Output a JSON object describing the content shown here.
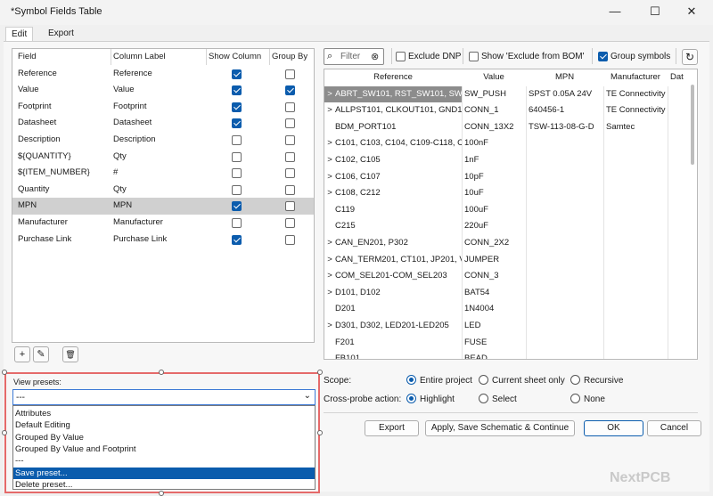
{
  "window": {
    "title": "*Symbol Fields Table",
    "minimize": "—",
    "maximize": "☐",
    "close": "✕"
  },
  "tabs": [
    "Edit",
    "Export"
  ],
  "fields_table": {
    "headers": [
      "Field",
      "Column Label",
      "Show Column",
      "Group By"
    ],
    "rows": [
      {
        "field": "Reference",
        "label": "Reference",
        "show": true,
        "group": false
      },
      {
        "field": "Value",
        "label": "Value",
        "show": true,
        "group": true
      },
      {
        "field": "Footprint",
        "label": "Footprint",
        "show": true,
        "group": false
      },
      {
        "field": "Datasheet",
        "label": "Datasheet",
        "show": true,
        "group": false
      },
      {
        "field": "Description",
        "label": "Description",
        "show": false,
        "group": false
      },
      {
        "field": "${QUANTITY}",
        "label": "Qty",
        "show": false,
        "group": false
      },
      {
        "field": "${ITEM_NUMBER}",
        "label": "#",
        "show": false,
        "group": false
      },
      {
        "field": "Quantity",
        "label": "Qty",
        "show": false,
        "group": false
      },
      {
        "field": "MPN",
        "label": "MPN",
        "show": true,
        "group": false,
        "selected": true
      },
      {
        "field": "Manufacturer",
        "label": "Manufacturer",
        "show": false,
        "group": false
      },
      {
        "field": "Purchase Link",
        "label": "Purchase Link",
        "show": true,
        "group": false
      }
    ]
  },
  "field_tools": {
    "add": "+",
    "edit": "✎",
    "delete": "🗑"
  },
  "filter": {
    "placeholder": "Filter",
    "clear": "⊗"
  },
  "options": {
    "exclude_dnp": {
      "label": "Exclude DNP",
      "checked": false
    },
    "show_excluded": {
      "label": "Show 'Exclude from BOM'",
      "checked": false
    },
    "group_symbols": {
      "label": "Group symbols",
      "checked": true
    }
  },
  "refresh_icon": "↻",
  "grid": {
    "headers": [
      "Reference",
      "Value",
      "MPN",
      "Manufacturer",
      "Dat"
    ],
    "sort_indicator": "^",
    "rows": [
      {
        "exp": ">",
        "ref": "ABRT_SW101, RST_SW101, SW201",
        "value": "SW_PUSH",
        "mpn": "SPST 0.05A 24V",
        "mfr": "TE Connectivity",
        "selected": true
      },
      {
        "exp": ">",
        "ref": "ALLPST101, CLKOUT101, GND101",
        "value": "CONN_1",
        "mpn": "640456-1",
        "mfr": "TE Connectivity"
      },
      {
        "exp": "",
        "ref": "BDM_PORT101",
        "value": "CONN_13X2",
        "mpn": "TSW-113-08-G-D",
        "mfr": "Samtec"
      },
      {
        "exp": ">",
        "ref": "C101, C103, C104, C109-C118, C2",
        "value": "100nF",
        "mpn": "",
        "mfr": ""
      },
      {
        "exp": ">",
        "ref": "C102, C105",
        "value": "1nF",
        "mpn": "",
        "mfr": ""
      },
      {
        "exp": ">",
        "ref": "C106, C107",
        "value": "10pF",
        "mpn": "",
        "mfr": ""
      },
      {
        "exp": ">",
        "ref": "C108, C212",
        "value": "10uF",
        "mpn": "",
        "mfr": ""
      },
      {
        "exp": "",
        "ref": "C119",
        "value": "100uF",
        "mpn": "",
        "mfr": ""
      },
      {
        "exp": "",
        "ref": "C215",
        "value": "220uF",
        "mpn": "",
        "mfr": ""
      },
      {
        "exp": ">",
        "ref": "CAN_EN201, P302",
        "value": "CONN_2X2",
        "mpn": "",
        "mfr": ""
      },
      {
        "exp": ">",
        "ref": "CAN_TERM201, CT101, JP201, VDD",
        "value": "JUMPER",
        "mpn": "",
        "mfr": ""
      },
      {
        "exp": ">",
        "ref": "COM_SEL201-COM_SEL203",
        "value": "CONN_3",
        "mpn": "",
        "mfr": ""
      },
      {
        "exp": ">",
        "ref": "D101, D102",
        "value": "BAT54",
        "mpn": "",
        "mfr": ""
      },
      {
        "exp": "",
        "ref": "D201",
        "value": "1N4004",
        "mpn": "",
        "mfr": ""
      },
      {
        "exp": ">",
        "ref": "D301, D302, LED201-LED205",
        "value": "LED",
        "mpn": "",
        "mfr": ""
      },
      {
        "exp": "",
        "ref": "F201",
        "value": "FUSE",
        "mpn": "",
        "mfr": ""
      },
      {
        "exp": "",
        "ref": "FB101",
        "value": "BEAD",
        "mpn": "",
        "mfr": ""
      }
    ]
  },
  "scope": {
    "label": "Scope:",
    "options": [
      "Entire project",
      "Current sheet only",
      "Recursive"
    ],
    "selected": 0
  },
  "crossprobe": {
    "label": "Cross-probe action:",
    "options": [
      "Highlight",
      "Select",
      "None"
    ],
    "selected": 0
  },
  "buttons": {
    "export": "Export",
    "apply": "Apply, Save Schematic & Continue",
    "ok": "OK",
    "cancel": "Cancel"
  },
  "presets": {
    "label": "View presets:",
    "value": "---",
    "items": [
      "Attributes",
      "Default Editing",
      "Grouped By Value",
      "Grouped By Value and Footprint",
      "---",
      "Save preset...",
      "Delete preset..."
    ],
    "selected_index": 5
  },
  "watermark": "NextPCB",
  "colors": {
    "accent": "#0b5cad",
    "highlight_box": "#e56a6a",
    "selected_row": "#8c8c8c"
  }
}
